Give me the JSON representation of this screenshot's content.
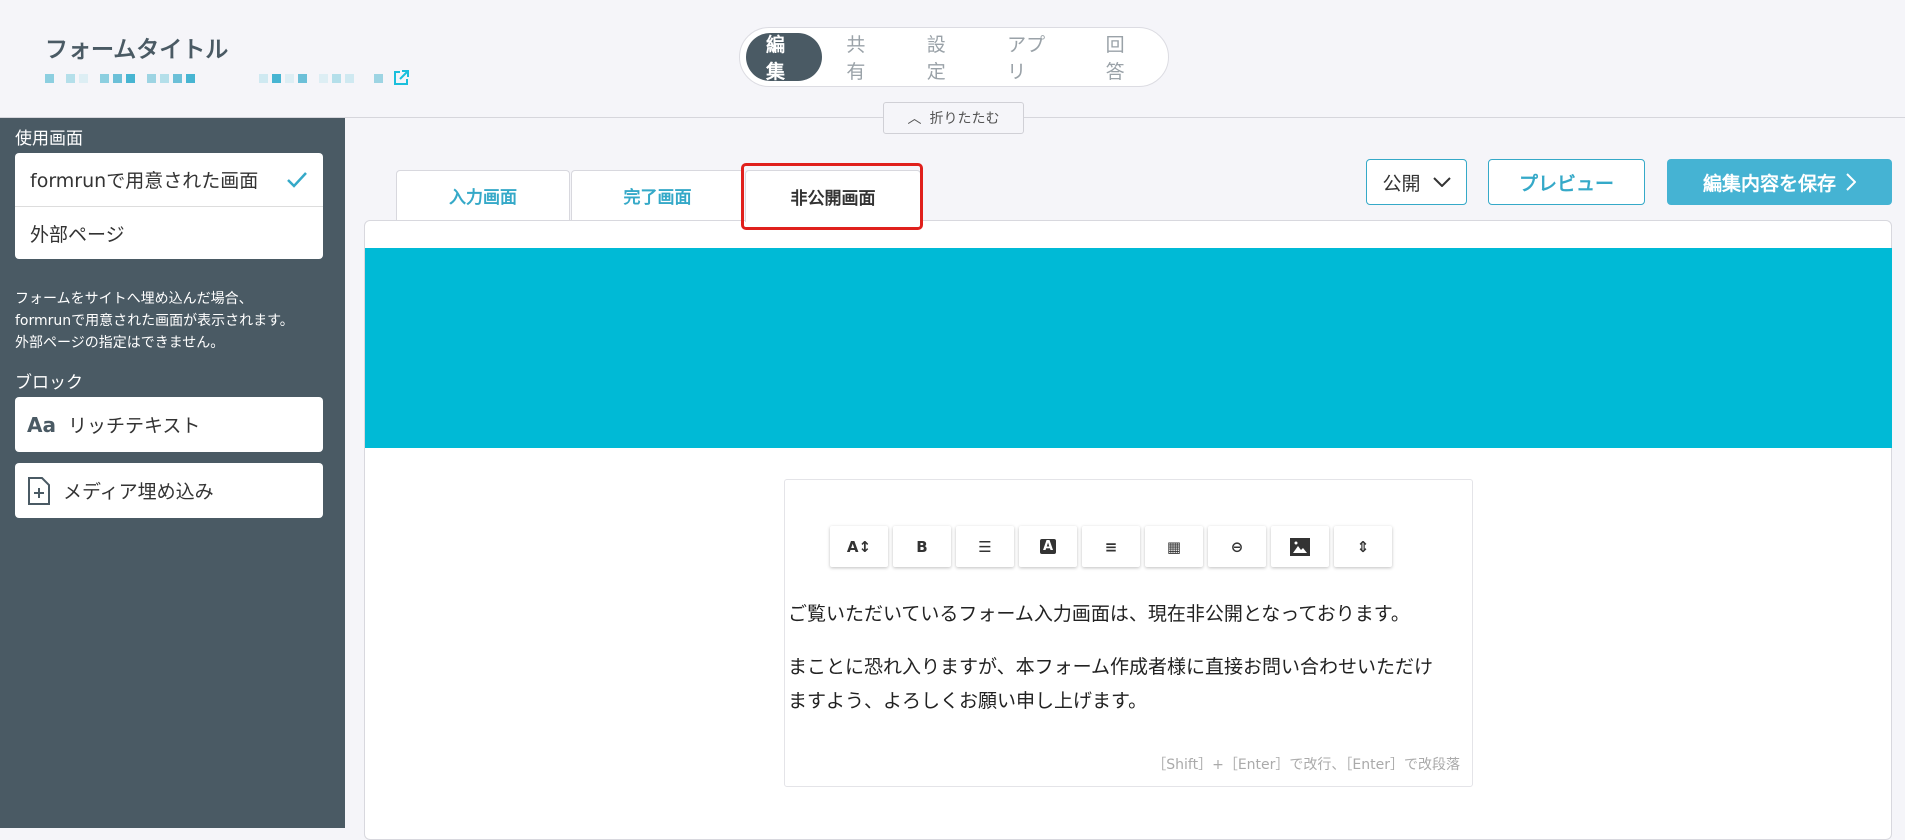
{
  "header": {
    "title": "フォームタイトル",
    "external_link_icon": "external-link-icon"
  },
  "nav": {
    "items": [
      {
        "label": "編集",
        "active": true
      },
      {
        "label": "共有"
      },
      {
        "label": "設定"
      },
      {
        "label": "アプリ"
      },
      {
        "label": "回答"
      }
    ]
  },
  "collapse": {
    "label": "折りたたむ"
  },
  "sidebar": {
    "screen_label": "使用画面",
    "options": [
      {
        "label": "formrunで用意された画面",
        "selected": true
      },
      {
        "label": "外部ページ"
      }
    ],
    "description": [
      "フォームをサイトへ埋め込んだ場合、",
      "formrunで用意された画面が表示されます。",
      "外部ページの指定はできません。"
    ],
    "block_label": "ブロック",
    "blocks": [
      {
        "label": "リッチテキスト",
        "icon": "Aa"
      },
      {
        "label": "メディア埋め込み",
        "icon": "file-plus-icon"
      }
    ]
  },
  "tabs": [
    {
      "label": "入力画面"
    },
    {
      "label": "完了画面"
    },
    {
      "label": "非公開画面",
      "active": true
    }
  ],
  "actions": {
    "status": "公開",
    "preview": "プレビュー",
    "save": "編集内容を保存"
  },
  "colors": {
    "accent": "#35a9c8",
    "banner": "#00bad6",
    "sidebar": "#4a5a64",
    "highlight": "#e0201c"
  },
  "editor": {
    "toolbar": [
      {
        "name": "font-size",
        "glyph": "A↕"
      },
      {
        "name": "bold",
        "glyph": "B"
      },
      {
        "name": "list",
        "glyph": "☰"
      },
      {
        "name": "text-color",
        "glyph": "A"
      },
      {
        "name": "align",
        "glyph": "≡"
      },
      {
        "name": "table",
        "glyph": "▦"
      },
      {
        "name": "link",
        "glyph": "⊖"
      },
      {
        "name": "image",
        "glyph": "▲"
      },
      {
        "name": "divider",
        "glyph": "⇕"
      }
    ],
    "line1": "ご覧いただいているフォーム入力画面は、現在非公開となっております。",
    "line2": "まことに恐れ入りますが、本フォーム作成者様に直接お問い合わせいただけ",
    "line3": "ますよう、よろしくお願い申し上げます。",
    "hint": "［Shift］+［Enter］で改行、［Enter］で改段落"
  }
}
